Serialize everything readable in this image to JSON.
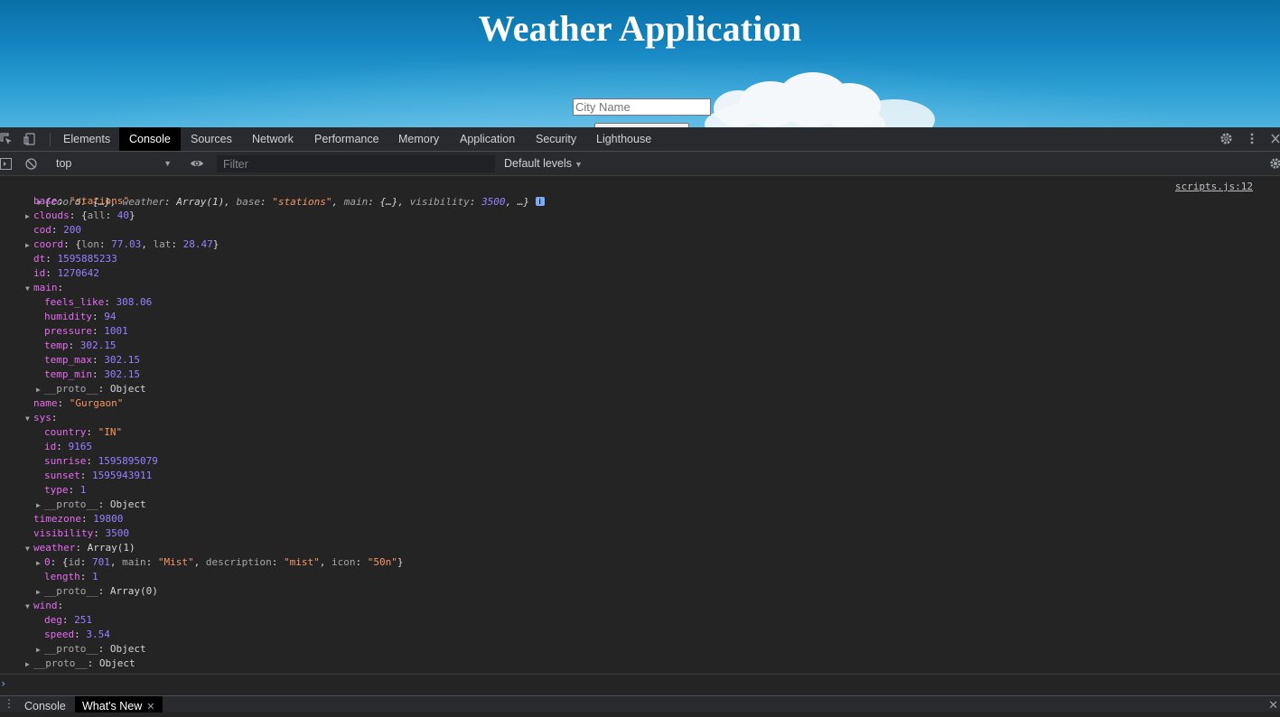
{
  "page": {
    "title": "Weather Application",
    "city_placeholder": "City Name"
  },
  "devtools": {
    "tabs": [
      "Elements",
      "Console",
      "Sources",
      "Network",
      "Performance",
      "Memory",
      "Application",
      "Security",
      "Lighthouse"
    ],
    "active_tab": "Console",
    "context": "top",
    "filter_placeholder": "Filter",
    "levels": "Default levels",
    "source_link": "scripts.js:12",
    "drawer_tabs": [
      "Console",
      "What's New"
    ],
    "active_drawer_tab": "What's New"
  },
  "console": {
    "summary": {
      "prefix": "{",
      "coord_key": "coord",
      "coord_val": "{…}",
      "weather_key": "weather",
      "weather_val": "Array(1)",
      "base_key": "base",
      "base_val": "\"stations\"",
      "main_key": "main",
      "main_val": "{…}",
      "visibility_key": "visibility",
      "visibility_val": "3500",
      "suffix": "…}"
    },
    "base": "\"stations\"",
    "clouds_all": "40",
    "cod": "200",
    "coord_lon": "77.03",
    "coord_lat": "28.47",
    "dt": "1595885233",
    "id": "1270642",
    "main": {
      "feels_like": "308.06",
      "humidity": "94",
      "pressure": "1001",
      "temp": "302.15",
      "temp_max": "302.15",
      "temp_min": "302.15"
    },
    "proto_object": "Object",
    "name": "\"Gurgaon\"",
    "sys": {
      "country": "\"IN\"",
      "id": "9165",
      "sunrise": "1595895079",
      "sunset": "1595943911",
      "type": "1"
    },
    "timezone": "19800",
    "visibility": "3500",
    "weather_type": "Array(1)",
    "weather_0": {
      "id": "701",
      "main": "\"Mist\"",
      "description": "\"mist\"",
      "icon": "\"50n\""
    },
    "weather_length": "1",
    "proto_array": "Array(0)",
    "wind": {
      "deg": "251",
      "speed": "3.54"
    }
  },
  "icons": {
    "inspect": "inspect-element-icon",
    "device": "device-toolbar-icon",
    "settings": "gear-icon",
    "more": "kebab-menu-icon",
    "close": "close-icon",
    "sidebar": "sidebar-toggle-icon",
    "clear": "clear-console-icon",
    "eye": "eye-icon",
    "info": "info-icon"
  }
}
